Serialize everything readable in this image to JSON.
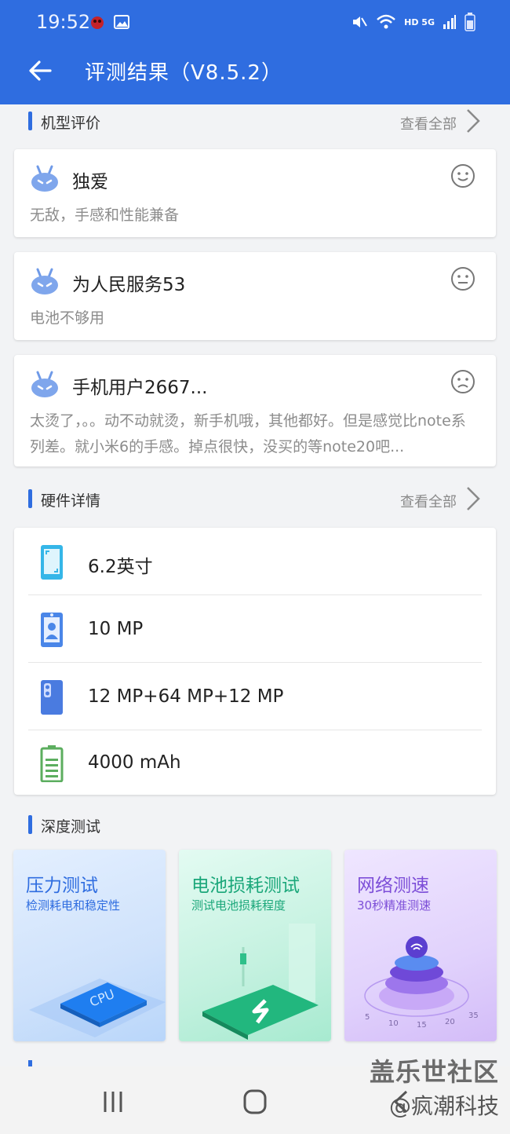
{
  "status_bar": {
    "time": "19:52",
    "network": "HD 5G"
  },
  "app_bar": {
    "title": "评测结果（V8.5.2）"
  },
  "sections": {
    "reviews": {
      "title": "机型评价",
      "more": "查看全部"
    },
    "hardware": {
      "title": "硬件详情",
      "more": "查看全部"
    },
    "deep_test": {
      "title": "深度测试"
    }
  },
  "reviews": [
    {
      "name": "独爱",
      "text": "无敌，手感和性能兼备",
      "mood": "happy-face-icon"
    },
    {
      "name": "为人民服务53",
      "text": "电池不够用",
      "mood": "neutral-face-icon"
    },
    {
      "name": "手机用户2667...",
      "text": "太烫了，。。动不动就烫，新手机哦，其他都好。但是感觉比note系列差。就小米6的手感。掉点很快，没买的等note20吧...",
      "mood": "sad-face-icon"
    }
  ],
  "hardware": [
    {
      "icon": "screen-icon",
      "text": "6.2英寸"
    },
    {
      "icon": "front-camera-icon",
      "text": "10 MP"
    },
    {
      "icon": "rear-camera-icon",
      "text": "12 MP+64 MP+12 MP"
    },
    {
      "icon": "battery-icon",
      "text": "4000 mAh"
    }
  ],
  "tests": [
    {
      "title": "压力测试",
      "subtitle": "检测耗电和稳定性",
      "color": "#2f6de0"
    },
    {
      "title": "电池损耗测试",
      "subtitle": "测试电池损耗程度",
      "color": "#1ba77a"
    },
    {
      "title": "网络测速",
      "subtitle": "30秒精准测速",
      "color": "#7d4fd8",
      "scale": [
        "5",
        "10",
        "15",
        "20",
        "35"
      ]
    }
  ],
  "watermark": {
    "line1": "盖乐世社区",
    "line2": "@疯潮科技"
  },
  "colors": {
    "primary": "#2f6de0",
    "background": "#f2f3f5"
  }
}
